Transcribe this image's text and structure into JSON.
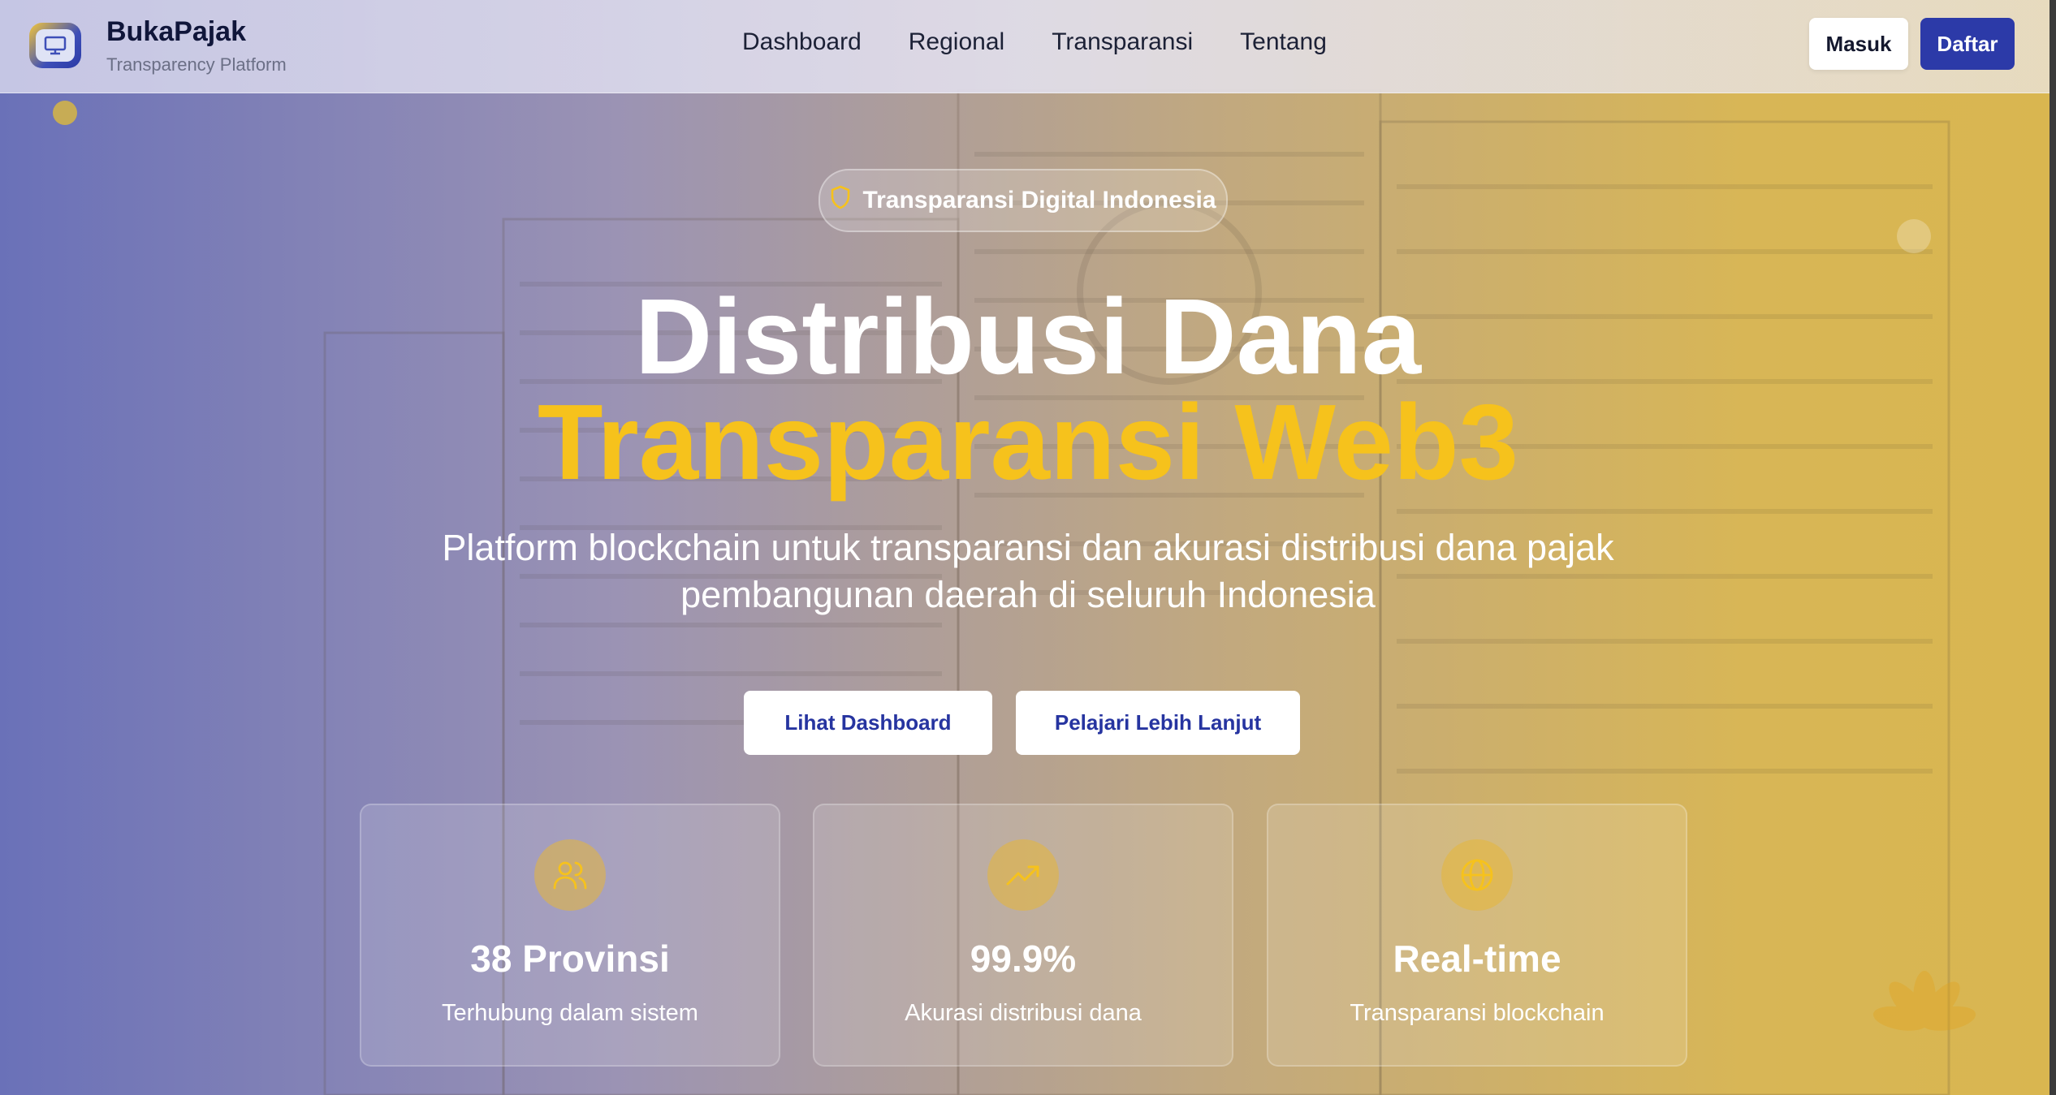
{
  "header": {
    "brand_name": "BukaPajak",
    "brand_subtitle": "Transparency Platform",
    "nav": [
      "Dashboard",
      "Regional",
      "Transparansi",
      "Tentang"
    ],
    "login_label": "Masuk",
    "register_label": "Daftar"
  },
  "hero": {
    "badge": "Transparansi Digital Indonesia",
    "title_line1": "Distribusi Dana",
    "title_line2": "Transparansi Web3",
    "subtitle": "Platform blockchain untuk transparansi dan akurasi distribusi dana pajak pembangunan daerah di seluruh Indonesia",
    "cta_primary": "Lihat Dashboard",
    "cta_secondary": "Pelajari Lebih Lanjut"
  },
  "stats": [
    {
      "value": "38 Provinsi",
      "label": "Terhubung dalam sistem",
      "icon": "users-icon"
    },
    {
      "value": "99.9%",
      "label": "Akurasi distribusi dana",
      "icon": "trending-up-icon"
    },
    {
      "value": "Real-time",
      "label": "Transparansi blockchain",
      "icon": "globe-icon"
    }
  ],
  "colors": {
    "accent_gold": "#f6c21c",
    "brand_blue": "#2c3aa8"
  }
}
